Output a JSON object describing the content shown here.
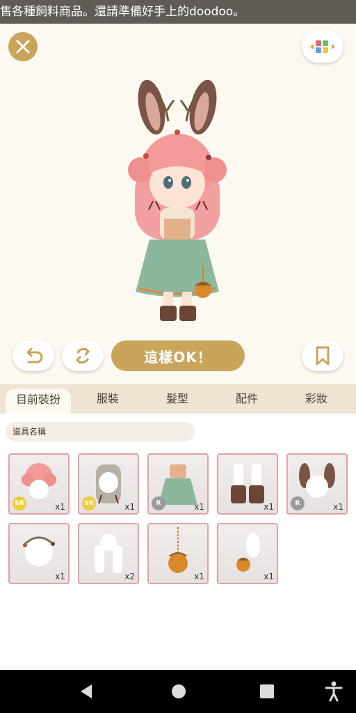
{
  "ticker": {
    "text": "售各種飼料商品。還請準備好手上的doodoo。"
  },
  "toolbar": {
    "ok_label": "這樣OK！"
  },
  "tabs": [
    {
      "label": "目前裝扮"
    },
    {
      "label": "服裝"
    },
    {
      "label": "髮型"
    },
    {
      "label": "配件"
    },
    {
      "label": "彩妝"
    }
  ],
  "search": {
    "placeholder": "道具名稱"
  },
  "items": [
    {
      "name": "pink-curly-hair",
      "rarity": "SR",
      "qty": "x1"
    },
    {
      "name": "braided-hair",
      "rarity": "SR",
      "qty": "x1"
    },
    {
      "name": "green-forest-dress",
      "rarity": "R",
      "qty": "x1"
    },
    {
      "name": "brown-boots",
      "rarity": "",
      "qty": "x1"
    },
    {
      "name": "antler-ears",
      "rarity": "R",
      "qty": "x1"
    },
    {
      "name": "berry-wreath",
      "rarity": "",
      "qty": "x1"
    },
    {
      "name": "hair-ribbons",
      "rarity": "",
      "qty": "x2"
    },
    {
      "name": "acorn-lantern",
      "rarity": "",
      "qty": "x1"
    },
    {
      "name": "acorn-bag",
      "rarity": "",
      "qty": "x1"
    }
  ],
  "colors": {
    "gold": "#c9a45b",
    "tab_bg": "#efe4d2",
    "item_border": "#e3a1a6"
  }
}
